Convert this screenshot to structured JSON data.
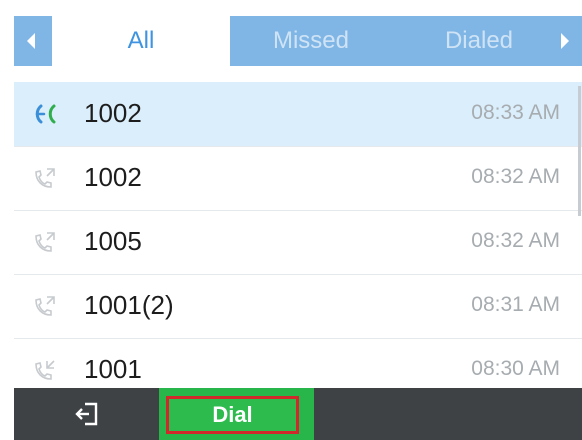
{
  "tabs": {
    "items": [
      {
        "label": "All",
        "active": true
      },
      {
        "label": "Missed",
        "active": false
      },
      {
        "label": "Dialed",
        "active": false
      }
    ],
    "left_arrow_icon": "chevron-left-icon",
    "right_arrow_icon": "chevron-right-icon"
  },
  "calls": [
    {
      "number": "1002",
      "time": "08:33 AM",
      "type": "active-call",
      "selected": true
    },
    {
      "number": "1002",
      "time": "08:32 AM",
      "type": "outgoing",
      "selected": false
    },
    {
      "number": "1005",
      "time": "08:32 AM",
      "type": "outgoing",
      "selected": false
    },
    {
      "number": "1001(2)",
      "time": "08:31 AM",
      "type": "outgoing",
      "selected": false
    },
    {
      "number": "1001",
      "time": "08:30 AM",
      "type": "incoming",
      "selected": false
    }
  ],
  "softkeys": {
    "back_icon": "exit-icon",
    "dial_label": "Dial"
  },
  "colors": {
    "tab_bar": "#7fb6e6",
    "tab_active_text": "#3e94e0",
    "selected_row": "#dbeefb",
    "softkey_bar": "#3f4245",
    "dial_green": "#2dbb4e",
    "dial_highlight_border": "#d0282b"
  }
}
